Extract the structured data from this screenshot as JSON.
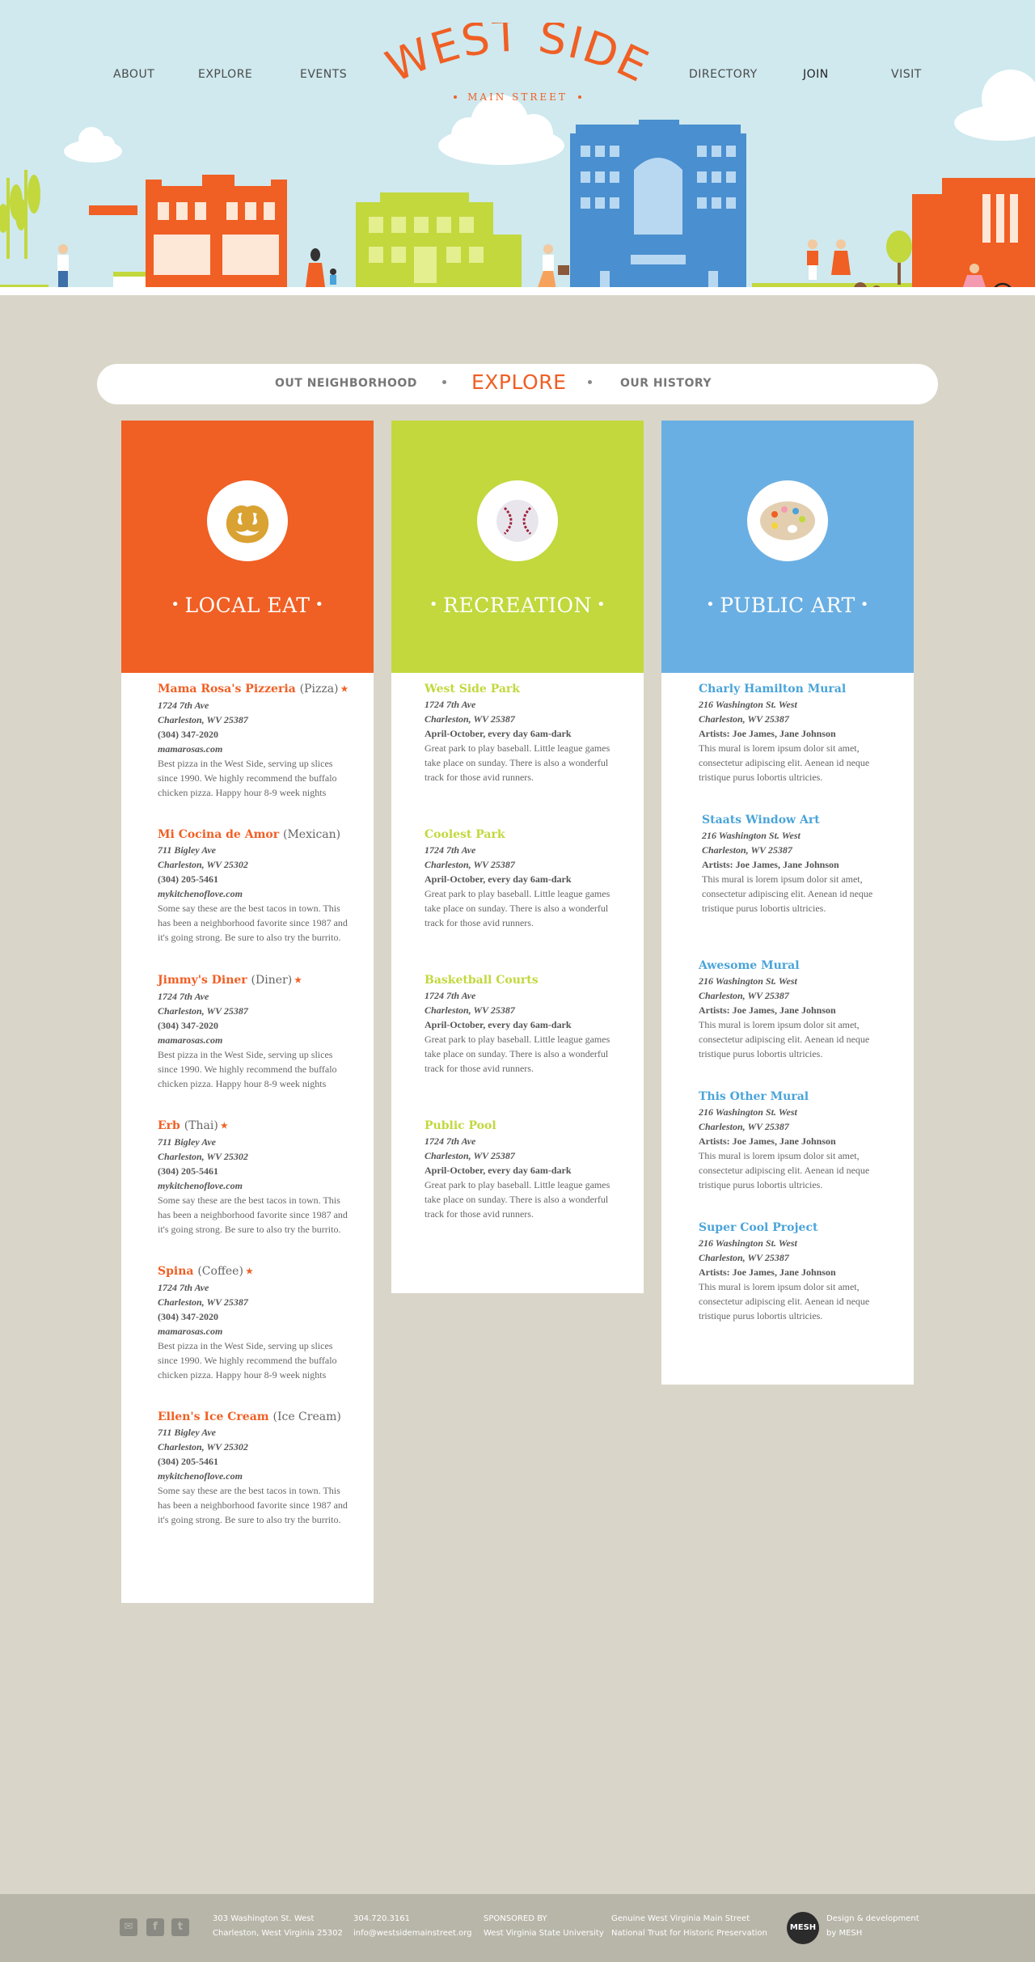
{
  "nav": {
    "about": "ABOUT",
    "explore": "EXPLORE",
    "events": "EVENTS",
    "directory": "DIRECTORY",
    "join": "JOIN",
    "visit": "VISIT"
  },
  "logo": {
    "title": "WEST SIDE",
    "subtitle": "MAIN STREET"
  },
  "hero_signs": {
    "shop_sign": "",
    "market_sign": ""
  },
  "subnav": {
    "left": "OUT NEIGHBORHOOD",
    "active": "EXPLORE",
    "right": "OUR HISTORY"
  },
  "colors": {
    "orange": "#f05f24",
    "green": "#c2d83d",
    "blue": "#6aafe3",
    "background": "#d9d6c9",
    "sky": "#cfe9ee"
  },
  "columns": {
    "eat": {
      "title": "LOCAL EAT",
      "icon": "pretzel-icon",
      "entries": [
        {
          "name": "Mama Rosa's Pizzeria",
          "kind": "(Pizza)",
          "star": "★",
          "addr1": "1724 7th Ave",
          "addr2": "Charleston, WV 25387",
          "phone": "(304) 347-2020",
          "web": "mamarosas.com",
          "desc": "Best pizza in the West Side, serving up slices since 1990. We highly recommend the buffalo chicken pizza. Happy hour 8-9 week nights"
        },
        {
          "name": "Mi Cocina de Amor",
          "kind": "(Mexican)",
          "star": "",
          "addr1": "711 Bigley Ave",
          "addr2": "Charleston, WV 25302",
          "phone": "(304) 205-5461",
          "web": "mykitchenoflove.com",
          "desc": "Some say these are the best tacos in town. This has been a neighborhood favorite since 1987 and it's going strong. Be sure to also try the burrito."
        },
        {
          "name": "Jimmy's Diner",
          "kind": "(Diner)",
          "star": "★",
          "addr1": "1724 7th Ave",
          "addr2": "Charleston, WV 25387",
          "phone": "(304) 347-2020",
          "web": "mamarosas.com",
          "desc": "Best pizza in the West Side, serving up slices since 1990. We highly recommend the buffalo chicken pizza. Happy hour 8-9 week nights"
        },
        {
          "name": "Erb",
          "kind": "(Thai)",
          "star": "★",
          "addr1": "711 Bigley Ave",
          "addr2": "Charleston, WV 25302",
          "phone": "(304) 205-5461",
          "web": "mykitchenoflove.com",
          "desc": "Some say these are the best tacos in town. This has been a neighborhood favorite since 1987 and it's going strong. Be sure to also try the burrito."
        },
        {
          "name": "Spina",
          "kind": "(Coffee)",
          "star": "★",
          "addr1": "1724 7th Ave",
          "addr2": "Charleston, WV 25387",
          "phone": "(304) 347-2020",
          "web": "mamarosas.com",
          "desc": "Best pizza in the West Side, serving up slices since 1990. We highly recommend the buffalo chicken pizza. Happy hour 8-9 week nights"
        },
        {
          "name": "Ellen's Ice Cream",
          "kind": "(Ice Cream)",
          "star": "",
          "addr1": "711 Bigley Ave",
          "addr2": "Charleston, WV 25302",
          "phone": "(304) 205-5461",
          "web": "mykitchenoflove.com",
          "desc": "Some say these are the best tacos in town. This has been a neighborhood favorite since 1987 and it's going strong. Be sure to also try the burrito."
        }
      ]
    },
    "rec": {
      "title": "RECREATION",
      "icon": "baseball-icon",
      "entries": [
        {
          "name": "West Side Park",
          "addr1": "1724 7th Ave",
          "addr2": "Charleston, WV 25387",
          "hours": "April-October, every day 6am-dark",
          "desc": "Great park to play baseball. Little league games take place on sunday. There is also a wonderful track for those avid runners."
        },
        {
          "name": "Coolest Park",
          "addr1": "1724 7th Ave",
          "addr2": "Charleston, WV 25387",
          "hours": "April-October, every day 6am-dark",
          "desc": "Great park to play baseball. Little league games take place on sunday. There is also a wonderful track for those avid runners."
        },
        {
          "name": "Basketball Courts",
          "addr1": "1724 7th Ave",
          "addr2": "Charleston, WV 25387",
          "hours": "April-October, every day 6am-dark",
          "desc": "Great park to play baseball. Little league games take place on sunday. There is also a wonderful track for those avid runners."
        },
        {
          "name": "Public Pool",
          "addr1": "1724 7th Ave",
          "addr2": "Charleston, WV 25387",
          "hours": "April-October, every day 6am-dark",
          "desc": "Great park to play baseball. Little league games take place on sunday. There is also a wonderful track for those avid runners."
        }
      ]
    },
    "art": {
      "title": "PUBLIC ART",
      "icon": "palette-icon",
      "entries": [
        {
          "name": "Charly Hamilton Mural",
          "addr1": "216 Washington St. West",
          "addr2": "Charleston, WV 25387",
          "artists": "Artists: Joe James, Jane Johnson",
          "desc": "This mural is lorem ipsum dolor sit amet, consectetur adipiscing elit. Aenean id neque tristique purus lobortis ultricies."
        },
        {
          "name": "Staats Window Art",
          "addr1": "216 Washington St. West",
          "addr2": "Charleston, WV 25387",
          "artists": "Artists: Joe James, Jane Johnson",
          "desc": "This mural is lorem ipsum dolor sit amet, consectetur adipiscing elit. Aenean id neque tristique purus lobortis ultricies."
        },
        {
          "name": "Awesome Mural",
          "addr1": "216 Washington St. West",
          "addr2": "Charleston, WV 25387",
          "artists": "Artists: Joe James, Jane Johnson",
          "desc": "This mural is lorem ipsum dolor sit amet, consectetur adipiscing elit. Aenean id neque tristique purus lobortis ultricies."
        },
        {
          "name": "This Other Mural",
          "addr1": "216 Washington St. West",
          "addr2": "Charleston, WV 25387",
          "artists": "Artists: Joe James, Jane Johnson",
          "desc": "This mural is lorem ipsum dolor sit amet, consectetur adipiscing elit. Aenean id neque tristique purus lobortis ultricies."
        },
        {
          "name": "Super Cool Project",
          "addr1": "216 Washington St. West",
          "addr2": "Charleston, WV 25387",
          "artists": "Artists: Joe James, Jane Johnson",
          "desc": "This mural is lorem ipsum dolor sit amet, consectetur adipiscing elit. Aenean id neque tristique purus lobortis ultricies."
        }
      ]
    }
  },
  "footer": {
    "icons": [
      "mail-icon",
      "facebook-icon",
      "twitter-icon"
    ],
    "address1": "303  Washington St. West",
    "address2": "Charleston, West Virginia 25302",
    "phone": "304.720.3161",
    "email": "info@westsidemainstreet.org",
    "sponsored_label": "SPONSORED BY",
    "sponsor": "West Virginia State University",
    "genuine1": "Genuine West Virginia Main Street",
    "genuine2": "National Trust for Historic Preservation",
    "mesh_logo": "MESH",
    "credit1": "Design & development",
    "credit2": "by MESH"
  }
}
